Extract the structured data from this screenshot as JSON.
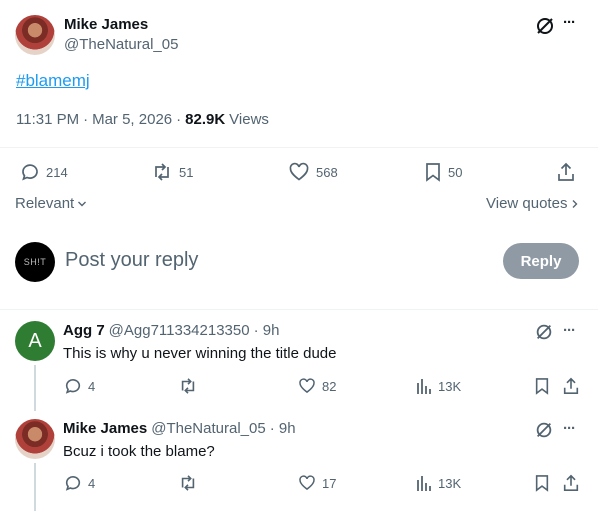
{
  "post": {
    "author_name": "Mike James",
    "author_handle": "@TheNatural_05",
    "hashtag": "#blamemj",
    "time": "11:31 PM",
    "date": "Mar 5, 2026",
    "sep": "·",
    "views_count": "82.9K",
    "views_label": "Views",
    "replies": "214",
    "reposts": "51",
    "likes": "568",
    "bookmarks": "50",
    "more": "···"
  },
  "sort": {
    "relevant_label": "Relevant",
    "view_quotes_label": "View quotes"
  },
  "composer": {
    "avatar_text": "SH!T",
    "placeholder": "Post your reply",
    "reply_label": "Reply"
  },
  "replies": [
    {
      "name": "Agg 7",
      "handle": "@Agg711334213350",
      "time": "· 9h",
      "avatar_letter": "A",
      "text": "This is why u never winning the title dude",
      "replies": "4",
      "likes": "82",
      "views": "13K",
      "more": "···"
    },
    {
      "name": "Mike James",
      "handle": "@TheNatural_05",
      "time": "· 9h",
      "text": "Bcuz i took the blame?",
      "replies": "4",
      "likes": "17",
      "views": "13K",
      "more": "···"
    }
  ],
  "colors": {
    "link": "#1d9bf0",
    "muted": "#536471",
    "reply_button": "#8f9aa4",
    "avatar_green": "#2e7d32"
  }
}
